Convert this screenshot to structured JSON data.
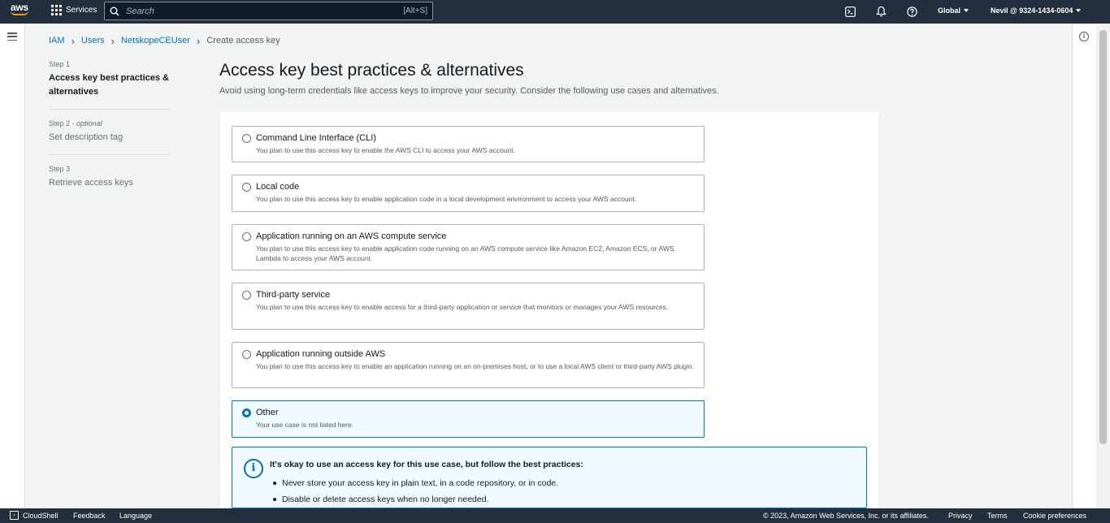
{
  "topnav": {
    "logo_text": "aws",
    "services_label": "Services",
    "search_placeholder": "Search",
    "search_shortcut": "[Alt+S]",
    "region": "Global",
    "account": "Nevil @ 9324-1434-0604",
    "icons": [
      "cloudshell-icon",
      "bell-icon",
      "help-icon"
    ]
  },
  "breadcrumb": {
    "items": [
      "IAM",
      "Users",
      "NetskopeCEUser"
    ],
    "current": "Create access key"
  },
  "steps": [
    {
      "num": "Step 1",
      "optional": "",
      "title": "Access key best practices & alternatives"
    },
    {
      "num": "Step 2 - ",
      "optional": "optional",
      "title": "Set description tag"
    },
    {
      "num": "Step 3",
      "optional": "",
      "title": "Retrieve access keys"
    }
  ],
  "main": {
    "title": "Access key best practices & alternatives",
    "description": "Avoid using long-term credentials like access keys to improve your security. Consider the following use cases and alternatives."
  },
  "options": [
    {
      "title": "Command Line Interface (CLI)",
      "desc": "You plan to use this access key to enable the AWS CLI to access your AWS account.",
      "selected": false
    },
    {
      "title": "Local code",
      "desc": "You plan to use this access key to enable application code in a local development environment to access your AWS account.",
      "selected": false
    },
    {
      "title": "Application running on an AWS compute service",
      "desc": "You plan to use this access key to enable application code running on an AWS compute service like Amazon EC2, Amazon ECS, or AWS Lambda to access your AWS account.",
      "selected": false
    },
    {
      "title": "Third-party service",
      "desc": "You plan to use this access key to enable access for a third-party application or service that monitors or manages your AWS resources.",
      "selected": false
    },
    {
      "title": "Application running outside AWS",
      "desc": "You plan to use this access key to enable an application running on an on-premises host, or to use a local AWS client or third-party AWS plugin.",
      "selected": false
    },
    {
      "title": "Other",
      "desc": "Your use case is not listed here.",
      "selected": true
    }
  ],
  "alert": {
    "title": "It's okay to use an access key for this use case, but follow the best practices:",
    "items": [
      "Never store your access key in plain text, in a code repository, or in code.",
      "Disable or delete access keys when no longer needed."
    ]
  },
  "footer": {
    "cloudshell": "CloudShell",
    "feedback": "Feedback",
    "language": "Language",
    "copyright": "© 2023, Amazon Web Services, Inc. or its affiliates.",
    "privacy": "Privacy",
    "terms": "Terms",
    "cookie": "Cookie preferences"
  },
  "colors": {
    "nav_bg": "#232f3e",
    "link": "#0073bb",
    "accent": "#ff9900"
  }
}
